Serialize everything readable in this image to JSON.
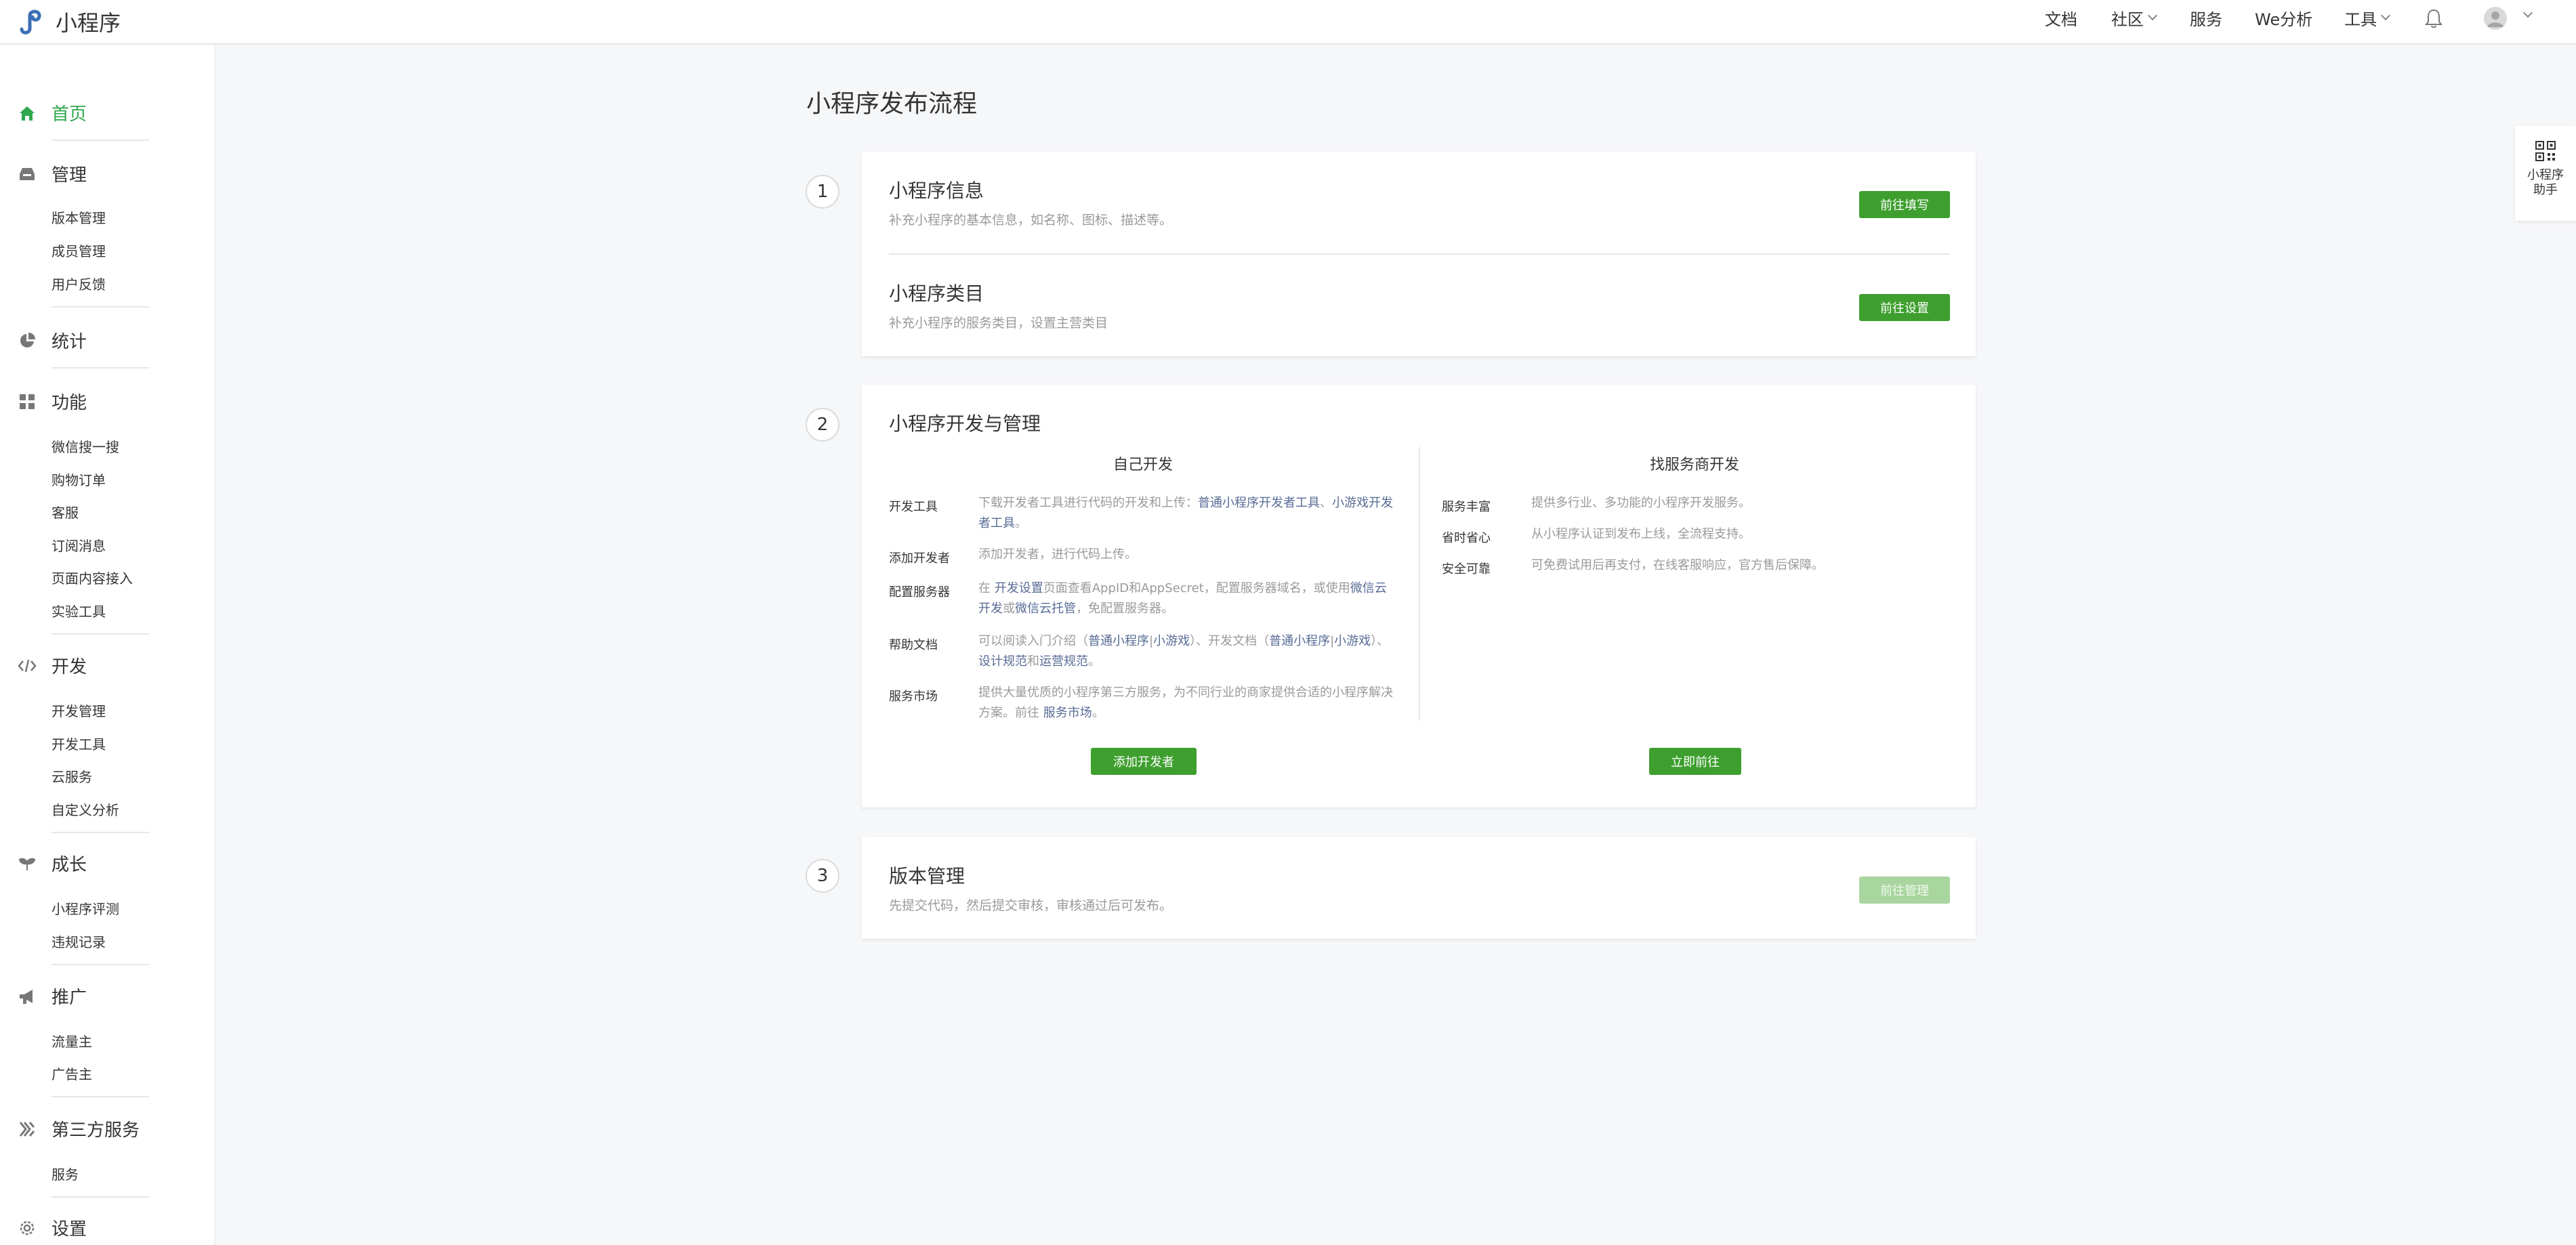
{
  "header": {
    "brand": "小程序",
    "nav": [
      {
        "label": "文档",
        "dropdown": false
      },
      {
        "label": "社区",
        "dropdown": true
      },
      {
        "label": "服务",
        "dropdown": false
      },
      {
        "label": "We分析",
        "dropdown": false
      },
      {
        "label": "工具",
        "dropdown": true
      }
    ]
  },
  "sidebar": {
    "sections": [
      {
        "label": "首页",
        "icon": "home-icon",
        "active": true,
        "items": []
      },
      {
        "label": "管理",
        "icon": "inbox-icon",
        "items": [
          "版本管理",
          "成员管理",
          "用户反馈"
        ]
      },
      {
        "label": "统计",
        "icon": "pie-chart-icon",
        "items": []
      },
      {
        "label": "功能",
        "icon": "grid-icon",
        "items": [
          "微信搜一搜",
          "购物订单",
          "客服",
          "订阅消息",
          "页面内容接入",
          "实验工具"
        ]
      },
      {
        "label": "开发",
        "icon": "code-icon",
        "items": [
          "开发管理",
          "开发工具",
          "云服务",
          "自定义分析"
        ]
      },
      {
        "label": "成长",
        "icon": "sprout-icon",
        "items": [
          "小程序评测",
          "违规记录"
        ]
      },
      {
        "label": "推广",
        "icon": "megaphone-icon",
        "items": [
          "流量主",
          "广告主"
        ]
      },
      {
        "label": "第三方服务",
        "icon": "third-party-icon",
        "items": [
          "服务"
        ]
      },
      {
        "label": "设置",
        "icon": "settings-icon",
        "items": []
      }
    ]
  },
  "main": {
    "title": "小程序发布流程",
    "steps": [
      {
        "number": "1",
        "blocks": [
          {
            "title": "小程序信息",
            "desc": "补充小程序的基本信息，如名称、图标、描述等。",
            "button": "前往填写"
          },
          {
            "title": "小程序类目",
            "desc": "补充小程序的服务类目，设置主营类目",
            "button": "前往设置"
          }
        ]
      },
      {
        "number": "2",
        "title": "小程序开发与管理",
        "left": {
          "heading": "自己开发",
          "rows": [
            {
              "label": "开发工具",
              "text": [
                "下载开发者工具进行代码的开发和上传：",
                "普通小程序开发者工具",
                "、",
                "小游戏开发者工具",
                "。"
              ]
            },
            {
              "label": "添加开发者",
              "text": [
                "添加开发者，进行代码上传。"
              ]
            },
            {
              "label": "配置服务器",
              "text": [
                "在 ",
                "开发设置",
                "页面查看AppID和AppSecret，配置服务器域名，或使用",
                "微信云开发",
                "或",
                "微信云托管",
                "，免配置服务器。"
              ]
            },
            {
              "label": "帮助文档",
              "text": [
                "可以阅读入门介绍（",
                "普通小程序",
                "|",
                "小游戏",
                "）、开发文档（",
                "普通小程序",
                "|",
                "小游戏",
                "）、",
                "设计规范",
                "和",
                "运营规范",
                "。"
              ]
            },
            {
              "label": "服务市场",
              "text": [
                "提供大量优质的小程序第三方服务，为不同行业的商家提供合适的小程序解决方案。前往 ",
                "服务市场",
                "。"
              ]
            }
          ],
          "button": "添加开发者"
        },
        "right": {
          "heading": "找服务商开发",
          "rows": [
            {
              "label": "服务丰富",
              "text": "提供多行业、多功能的小程序开发服务。"
            },
            {
              "label": "省时省心",
              "text": "从小程序认证到发布上线，全流程支持。"
            },
            {
              "label": "安全可靠",
              "text": "可免费试用后再支付，在线客服响应，官方售后保障。"
            }
          ],
          "button": "立即前往"
        }
      },
      {
        "number": "3",
        "title": "版本管理",
        "desc": "先提交代码，然后提交审核，审核通过后可发布。",
        "button": "前往管理",
        "button_disabled": true
      }
    ]
  },
  "assistant": {
    "label": "小程序助手"
  },
  "colors": {
    "accent": "#3e9f2e",
    "active": "#2fa84f",
    "link": "#576b95",
    "muted": "#9a9a9a"
  }
}
